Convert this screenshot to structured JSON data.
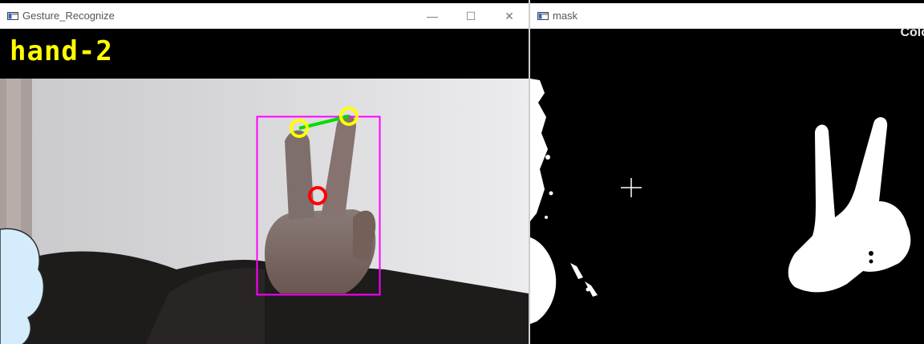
{
  "windows": [
    {
      "title": "Gesture_Recognize",
      "controls": {
        "minimize": "—",
        "maximize": "☐",
        "close": "✕"
      },
      "overlay_label": "hand-2"
    },
    {
      "title": "mask",
      "overlay_label": "Colo"
    }
  ],
  "colors": {
    "label": "#ffff00",
    "bounding_box": "#ff00ff",
    "fingertip_marker": "#ffff00",
    "finger_link": "#00dd00",
    "center_marker": "#ff0000",
    "mask_foreground": "#ffffff",
    "mask_background": "#000000"
  },
  "icons": {
    "app": "window-app-icon",
    "cursor": "crosshair-cursor-icon"
  }
}
